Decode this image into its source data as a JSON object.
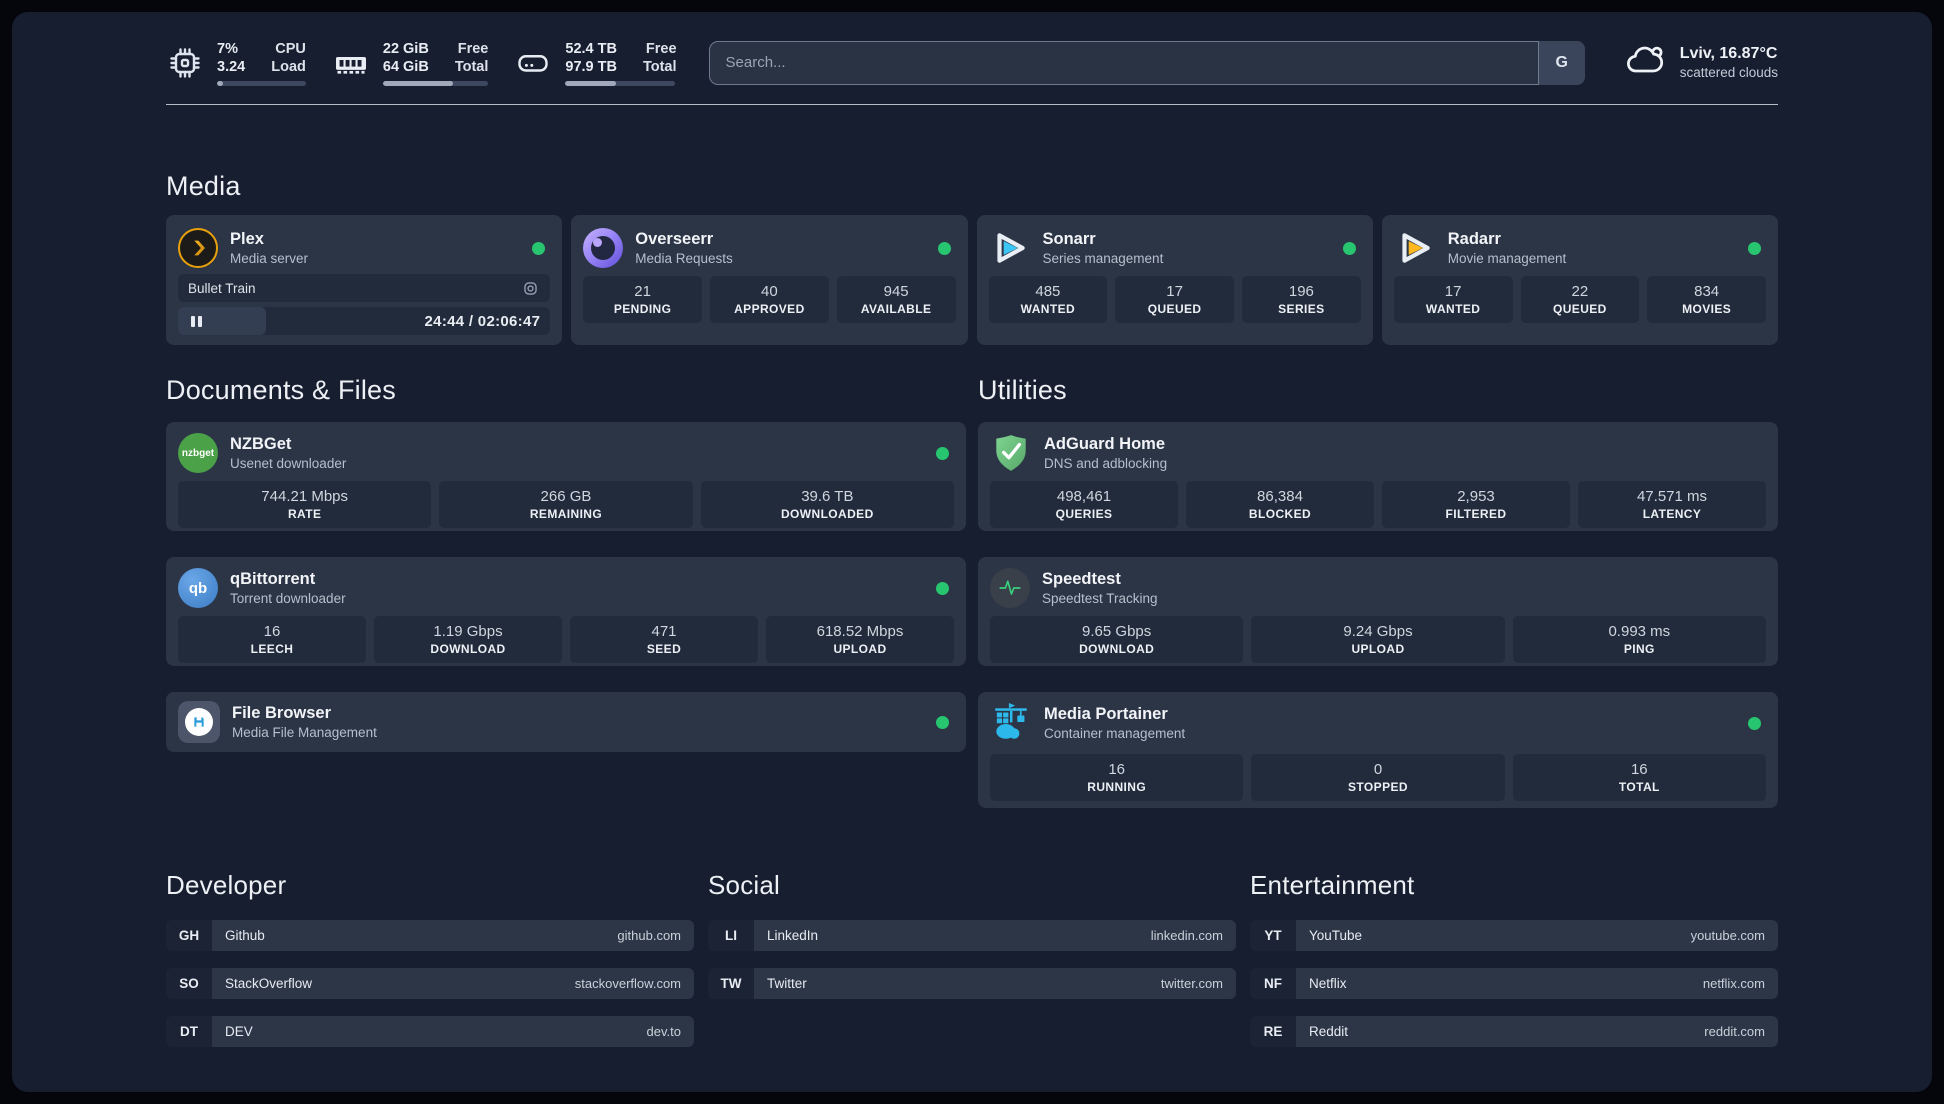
{
  "colors": {
    "background": "#171e30",
    "card": "#2c3546",
    "status_online": "#27c56f",
    "plex_accent": "#e8a00c",
    "sonarr_accent": "#3bc7f5",
    "radarr_accent": "#ffb81f",
    "nzbget_accent": "#4aa147",
    "qbittorrent_accent": "#4281c9",
    "adguard_accent": "#67b87a",
    "speedtest_accent": "#38d07d",
    "portainer_accent": "#2cb8ea"
  },
  "header": {
    "stats": [
      {
        "icon": "cpu-icon",
        "value_top": "7%",
        "value_bottom": "3.24",
        "label_top": "CPU",
        "label_bottom": "Load",
        "progress_pct": 7
      },
      {
        "icon": "memory-icon",
        "value_top": "22 GiB",
        "value_bottom": "64 GiB",
        "label_top": "Free",
        "label_bottom": "Total",
        "progress_pct": 66
      },
      {
        "icon": "disk-icon",
        "value_top": "52.4 TB",
        "value_bottom": "97.9 TB",
        "label_top": "Free",
        "label_bottom": "Total",
        "progress_pct": 46
      }
    ],
    "search": {
      "placeholder": "Search...",
      "engine_label": "G"
    },
    "weather": {
      "location_temp": "Lviv, 16.87°C",
      "condition": "scattered clouds"
    }
  },
  "sections": {
    "media": {
      "title": "Media",
      "plex": {
        "title": "Plex",
        "subtitle": "Media server",
        "now_playing": "Bullet Train",
        "time": "24:44 / 02:06:47"
      },
      "overseerr": {
        "title": "Overseerr",
        "subtitle": "Media Requests",
        "stats": [
          {
            "value": "21",
            "label": "PENDING"
          },
          {
            "value": "40",
            "label": "APPROVED"
          },
          {
            "value": "945",
            "label": "AVAILABLE"
          }
        ]
      },
      "sonarr": {
        "title": "Sonarr",
        "subtitle": "Series management",
        "stats": [
          {
            "value": "485",
            "label": "WANTED"
          },
          {
            "value": "17",
            "label": "QUEUED"
          },
          {
            "value": "196",
            "label": "SERIES"
          }
        ]
      },
      "radarr": {
        "title": "Radarr",
        "subtitle": "Movie management",
        "stats": [
          {
            "value": "17",
            "label": "WANTED"
          },
          {
            "value": "22",
            "label": "QUEUED"
          },
          {
            "value": "834",
            "label": "MOVIES"
          }
        ]
      }
    },
    "documents": {
      "title": "Documents & Files",
      "nzbget": {
        "title": "NZBGet",
        "subtitle": "Usenet downloader",
        "icon_text": "nzbget",
        "stats": [
          {
            "value": "744.21 Mbps",
            "label": "RATE"
          },
          {
            "value": "266 GB",
            "label": "REMAINING"
          },
          {
            "value": "39.6 TB",
            "label": "DOWNLOADED"
          }
        ]
      },
      "qbittorrent": {
        "title": "qBittorrent",
        "subtitle": "Torrent downloader",
        "icon_text": "qb",
        "stats": [
          {
            "value": "16",
            "label": "LEECH"
          },
          {
            "value": "1.19 Gbps",
            "label": "DOWNLOAD"
          },
          {
            "value": "471",
            "label": "SEED"
          },
          {
            "value": "618.52 Mbps",
            "label": "UPLOAD"
          }
        ]
      },
      "filebrowser": {
        "title": "File Browser",
        "subtitle": "Media File Management"
      }
    },
    "utilities": {
      "title": "Utilities",
      "adguard": {
        "title": "AdGuard Home",
        "subtitle": "DNS and adblocking",
        "stats": [
          {
            "value": "498,461",
            "label": "QUERIES"
          },
          {
            "value": "86,384",
            "label": "BLOCKED"
          },
          {
            "value": "2,953",
            "label": "FILTERED"
          },
          {
            "value": "47.571 ms",
            "label": "LATENCY"
          }
        ]
      },
      "speedtest": {
        "title": "Speedtest",
        "subtitle": "Speedtest Tracking",
        "stats": [
          {
            "value": "9.65 Gbps",
            "label": "DOWNLOAD"
          },
          {
            "value": "9.24 Gbps",
            "label": "UPLOAD"
          },
          {
            "value": "0.993 ms",
            "label": "PING"
          }
        ]
      },
      "portainer": {
        "title": "Media Portainer",
        "subtitle": "Container management",
        "stats": [
          {
            "value": "16",
            "label": "RUNNING"
          },
          {
            "value": "0",
            "label": "STOPPED"
          },
          {
            "value": "16",
            "label": "TOTAL"
          }
        ]
      }
    },
    "bookmarks": [
      {
        "title": "Developer",
        "links": [
          {
            "abbr": "GH",
            "name": "Github",
            "domain": "github.com"
          },
          {
            "abbr": "SO",
            "name": "StackOverflow",
            "domain": "stackoverflow.com"
          },
          {
            "abbr": "DT",
            "name": "DEV",
            "domain": "dev.to"
          }
        ]
      },
      {
        "title": "Social",
        "links": [
          {
            "abbr": "LI",
            "name": "LinkedIn",
            "domain": "linkedin.com"
          },
          {
            "abbr": "TW",
            "name": "Twitter",
            "domain": "twitter.com"
          }
        ]
      },
      {
        "title": "Entertainment",
        "links": [
          {
            "abbr": "YT",
            "name": "YouTube",
            "domain": "youtube.com"
          },
          {
            "abbr": "NF",
            "name": "Netflix",
            "domain": "netflix.com"
          },
          {
            "abbr": "RE",
            "name": "Reddit",
            "domain": "reddit.com"
          }
        ]
      }
    ]
  }
}
